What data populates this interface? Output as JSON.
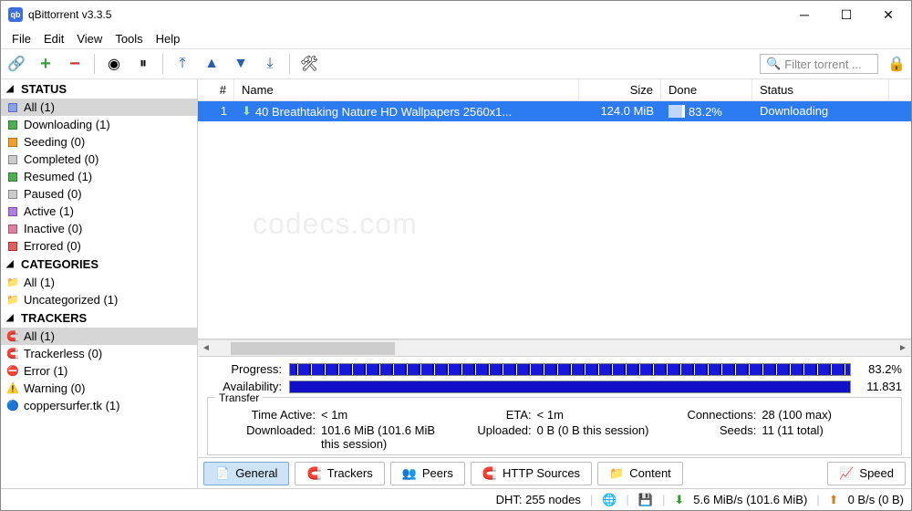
{
  "window": {
    "title": "qBittorrent v3.3.5"
  },
  "menu": [
    "File",
    "Edit",
    "View",
    "Tools",
    "Help"
  ],
  "filter_placeholder": "Filter torrent ...",
  "toolbar_icons": [
    "link",
    "add",
    "remove",
    "play",
    "pause",
    "top",
    "up",
    "down",
    "bottom",
    "settings"
  ],
  "sidebar": {
    "status_header": "STATUS",
    "status": [
      {
        "label": "All (1)",
        "color": "blue",
        "selected": true
      },
      {
        "label": "Downloading (1)",
        "color": "green"
      },
      {
        "label": "Seeding (0)",
        "color": "orange"
      },
      {
        "label": "Completed (0)",
        "color": "grey"
      },
      {
        "label": "Resumed (1)",
        "color": "green"
      },
      {
        "label": "Paused (0)",
        "color": "grey"
      },
      {
        "label": "Active (1)",
        "color": "purple"
      },
      {
        "label": "Inactive (0)",
        "color": "pink"
      },
      {
        "label": "Errored (0)",
        "color": "red"
      }
    ],
    "categories_header": "CATEGORIES",
    "categories": [
      {
        "label": "All (1)",
        "icon": "📁"
      },
      {
        "label": "Uncategorized (1)",
        "icon": "📁"
      }
    ],
    "trackers_header": "TRACKERS",
    "trackers": [
      {
        "label": "All (1)",
        "icon": "🧲",
        "selected": true
      },
      {
        "label": "Trackerless (0)",
        "icon": "🧲"
      },
      {
        "label": "Error (1)",
        "icon": "⛔"
      },
      {
        "label": "Warning (0)",
        "icon": "⚠️"
      },
      {
        "label": "coppersurfer.tk (1)",
        "icon": "🔵"
      }
    ]
  },
  "table": {
    "headers": {
      "num": "#",
      "name": "Name",
      "size": "Size",
      "done": "Done",
      "status": "Status"
    },
    "rows": [
      {
        "num": "1",
        "name": "40 Breathtaking Nature HD Wallpapers 2560x1...",
        "size": "124.0 MiB",
        "done": "83.2%",
        "status": "Downloading"
      }
    ]
  },
  "details": {
    "progress_label": "Progress:",
    "progress_value": "83.2%",
    "availability_label": "Availability:",
    "availability_value": "11.831",
    "transfer_header": "Transfer",
    "time_active_k": "Time Active:",
    "time_active_v": "< 1m",
    "eta_k": "ETA:",
    "eta_v": "< 1m",
    "connections_k": "Connections:",
    "connections_v": "28 (100 max)",
    "downloaded_k": "Downloaded:",
    "downloaded_v": "101.6 MiB (101.6 MiB this session)",
    "uploaded_k": "Uploaded:",
    "uploaded_v": "0 B (0 B this session)",
    "seeds_k": "Seeds:",
    "seeds_v": "11 (11 total)"
  },
  "tabs": {
    "general": "General",
    "trackers": "Trackers",
    "peers": "Peers",
    "http": "HTTP Sources",
    "content": "Content",
    "speed": "Speed"
  },
  "statusbar": {
    "dht": "DHT: 255 nodes",
    "down": "5.6 MiB/s (101.6 MiB)",
    "up": "0 B/s (0 B)"
  },
  "watermark": "codecs.com"
}
